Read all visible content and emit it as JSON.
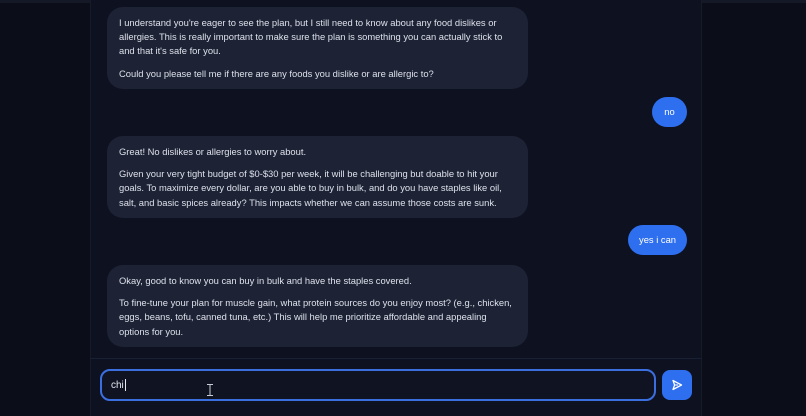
{
  "messages": {
    "ai1": {
      "p1": "I understand you're eager to see the plan, but I still need to know about any food dislikes or allergies. This is really important to make sure the plan is something you can actually stick to and that it's safe for you.",
      "p2": "Could you please tell me if there are any foods you dislike or are allergic to?"
    },
    "user1": "no",
    "ai2": {
      "p1": "Great! No dislikes or allergies to worry about.",
      "p2": "Given your very tight budget of $0-$30 per week, it will be challenging but doable to hit your goals. To maximize every dollar, are you able to buy in bulk, and do you have staples like oil, salt, and basic spices already? This impacts whether we can assume those costs are sunk."
    },
    "user2": "yes i can",
    "ai3": {
      "p1": "Okay, good to know you can buy in bulk and have the staples covered.",
      "p2": "To fine-tune your plan for muscle gain, what protein sources do you enjoy most? (e.g., chicken, eggs, beans, tofu, canned tuna, etc.) This will help me prioritize affordable and appealing options for you."
    }
  },
  "composer": {
    "input_value": "chi",
    "send_icon": "send-icon"
  },
  "colors": {
    "background": "#0b0d18",
    "panel": "#0e1120",
    "ai_bubble": "#1d2234",
    "user_bubble": "#2e6ff0",
    "accent": "#3b6fe0"
  }
}
